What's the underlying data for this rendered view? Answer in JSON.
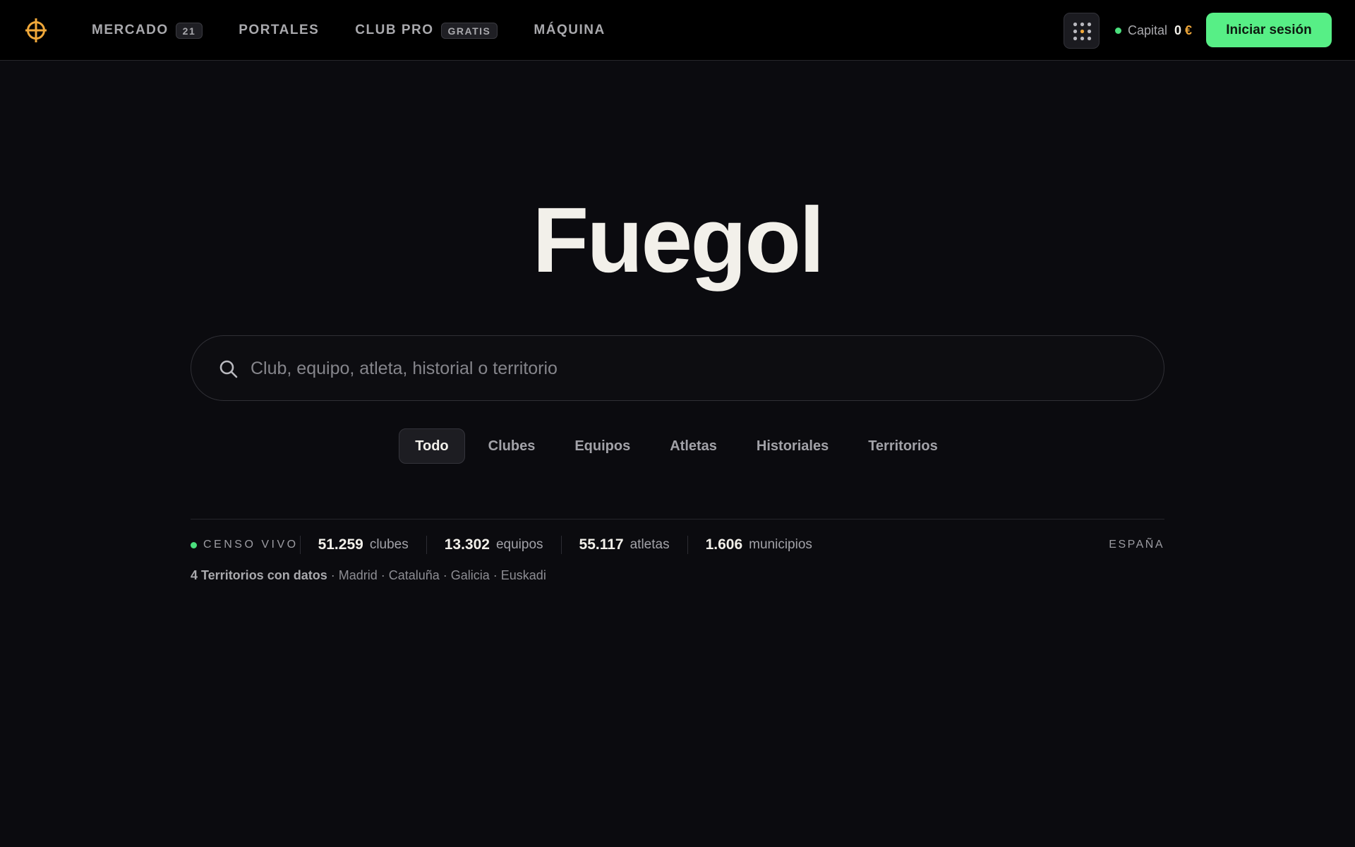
{
  "brand": {
    "logo_icon": "crosshair-globe-icon",
    "accent_color": "#f0a83a"
  },
  "nav": {
    "items": [
      {
        "label": "MERCADO",
        "badge": "21"
      },
      {
        "label": "PORTALES",
        "badge": null
      },
      {
        "label": "CLUB PRO",
        "badge": "GRATIS"
      },
      {
        "label": "MÁQUINA",
        "badge": null
      }
    ]
  },
  "header": {
    "apps_icon": "grid-dots-icon",
    "capital_label": "Capital",
    "capital_value": "0",
    "capital_currency": "€",
    "status_color": "#4be07d",
    "login_label": "Iniciar sesión",
    "login_color": "#57ef86"
  },
  "hero": {
    "title": "Fuegol"
  },
  "search": {
    "placeholder": "Club, equipo, atleta, historial o territorio",
    "value": "",
    "icon": "search-icon"
  },
  "filters": {
    "items": [
      {
        "label": "Todo",
        "active": true
      },
      {
        "label": "Clubes",
        "active": false
      },
      {
        "label": "Equipos",
        "active": false
      },
      {
        "label": "Atletas",
        "active": false
      },
      {
        "label": "Historiales",
        "active": false
      },
      {
        "label": "Territorios",
        "active": false
      }
    ]
  },
  "census": {
    "live_label": "CENSO VIVO",
    "stats": [
      {
        "value": "51.259",
        "label": "clubes"
      },
      {
        "value": "13.302",
        "label": "equipos"
      },
      {
        "value": "55.117",
        "label": "atletas"
      },
      {
        "value": "1.606",
        "label": "municipios"
      }
    ],
    "country": "ESPAÑA",
    "territories_lead": "4 Territorios con datos",
    "territories_list": " · Madrid · Cataluña · Galicia · Euskadi"
  }
}
